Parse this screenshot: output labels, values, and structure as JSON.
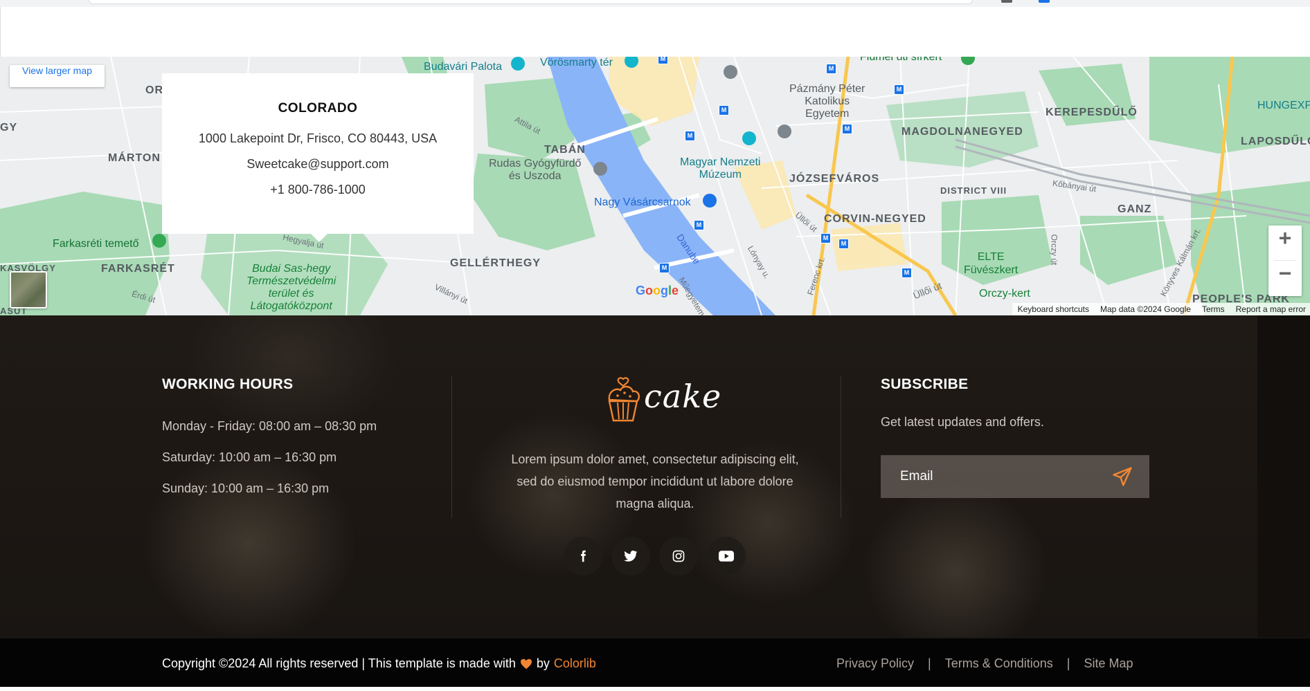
{
  "map": {
    "larger_map_label": "View larger map",
    "info_card": {
      "city": "COLORADO",
      "address": "1000 Lakepoint Dr, Frisco, CO 80443, USA",
      "email": "Sweetcake@support.com",
      "phone": "+1 800-786-1000"
    },
    "labels": {
      "budavari": "Budavári Palota",
      "vorosmarty": "Vörösmarty tér",
      "fiumei": "Fiumei úti sírkert",
      "pazmany": "Pázmány Péter\nKatolikus\nEgyetem",
      "hungexpo": "HUNGEXP",
      "kerepesdulo": "KEREPESDŰLŐ",
      "magdolna": "MAGDOLNANEGYED",
      "laposdulo": "LAPOSDŰLŐ",
      "orsz": "OR",
      "marton": "MÁRTON",
      "y_left": "GY",
      "taban": "TABÁN",
      "rudas": "Rudas Gyógyfürdő\nés Uszoda",
      "attila": "Attila út",
      "magyar_nemzeti": "Magyar Nemzeti\nMúzeum",
      "jozsefvaros": "JÓZSEFVÁROS",
      "district8": "DISTRICT VIII",
      "kobanyai": "Kőbányai út",
      "ganz": "GANZ",
      "nagy_vasarcsarnok": "Nagy Vásárcsarnok",
      "corvin": "CORVIN-NEGYED",
      "ulloi1": "Üllői út",
      "farkasreti_temeto": "Farkasréti temető",
      "farkasret": "FARKASRÉT",
      "hegyalja": "Hegyalja út",
      "gellerthegy": "GELLÉRTHEGY",
      "danube": "Danube",
      "lonyay": "Lónyay u.",
      "ferenc": "Ferenc krt.",
      "elte": "ELTE\nFüvészkert",
      "orczy": "Orczy út",
      "kalman": "Könyves Kálmán krt.",
      "budai": "Budai Sas-hegy\nTermészetvédelmi\nterület és\nLátogatóközpont",
      "kasvolgy": "KASVÖLGY",
      "erdi": "Érdi út",
      "villanyi": "Villányi út",
      "muegyetem": "Műegyetem",
      "ulloi2": "Üllői út",
      "orczy_kert": "Orczy-kert",
      "peoples_park": "PEOPLE'S PARK",
      "asut": "ASUT"
    },
    "google": "Google",
    "zoom_in": "+",
    "zoom_out": "−",
    "attribution": [
      "Keyboard shortcuts",
      "Map data ©2024 Google",
      "Terms",
      "Report a map error"
    ]
  },
  "footer": {
    "working_hours": {
      "heading": "WORKING HOURS",
      "lines": [
        "Monday - Friday: 08:00 am – 08:30 pm",
        "Saturday: 10:00 am – 16:30 pm",
        "Sunday: 10:00 am – 16:30 pm"
      ]
    },
    "brand": {
      "logo_text": "cake",
      "description": "Lorem ipsum dolor amet, consectetur adipiscing elit, sed do eiusmod tempor incididunt ut labore dolore magna aliqua.",
      "social": [
        "facebook-icon",
        "twitter-icon",
        "instagram-icon",
        "youtube-icon"
      ]
    },
    "subscribe": {
      "heading": "SUBSCRIBE",
      "subtext": "Get latest updates and offers.",
      "email_placeholder": "Email"
    },
    "bottom": {
      "copyright": "Copyright ©2024 All rights reserved | This template is made with",
      "by": "by",
      "brand": "Colorlib",
      "links": [
        "Privacy Policy",
        "Terms & Conditions",
        "Site Map"
      ],
      "separator": "|"
    }
  },
  "colors": {
    "accent": "#f08632",
    "map_water": "#8ab4f8",
    "map_green": "#a8dab5",
    "map_yellow": "#fde293"
  }
}
